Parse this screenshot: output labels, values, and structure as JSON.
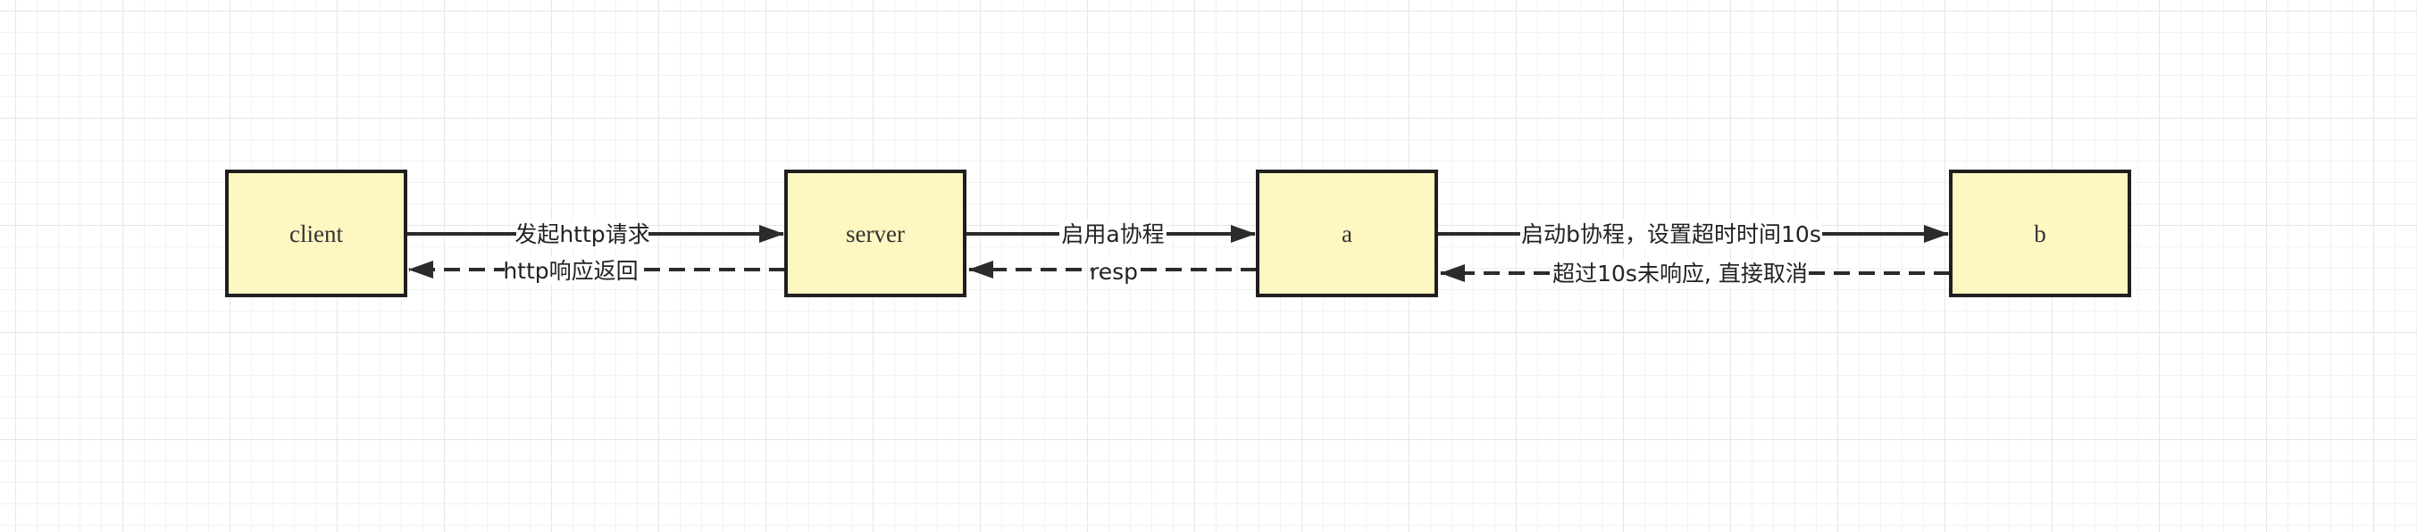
{
  "nodes": [
    {
      "id": "client",
      "label": "client"
    },
    {
      "id": "server",
      "label": "server"
    },
    {
      "id": "a",
      "label": "a"
    },
    {
      "id": "b",
      "label": "b"
    }
  ],
  "edges": [
    {
      "id": "e1",
      "from": "client",
      "to": "server",
      "style": "solid",
      "label": "发起http请求"
    },
    {
      "id": "e2",
      "from": "server",
      "to": "client",
      "style": "dashed",
      "label": "http响应返回"
    },
    {
      "id": "e3",
      "from": "server",
      "to": "a",
      "style": "solid",
      "label": "启用a协程"
    },
    {
      "id": "e4",
      "from": "a",
      "to": "server",
      "style": "dashed",
      "label": "resp"
    },
    {
      "id": "e5",
      "from": "a",
      "to": "b",
      "style": "solid",
      "label": "启动b协程，设置超时时间10s"
    },
    {
      "id": "e6",
      "from": "b",
      "to": "a",
      "style": "dashed",
      "label": "超过10s未响应, 直接取消"
    }
  ],
  "colors": {
    "node_fill": "#fff7c2",
    "node_stroke": "#1f1f1f",
    "edge": "#2b2b2b",
    "grid_major": "#e6e6e6",
    "grid_minor": "#f2f2f2"
  }
}
